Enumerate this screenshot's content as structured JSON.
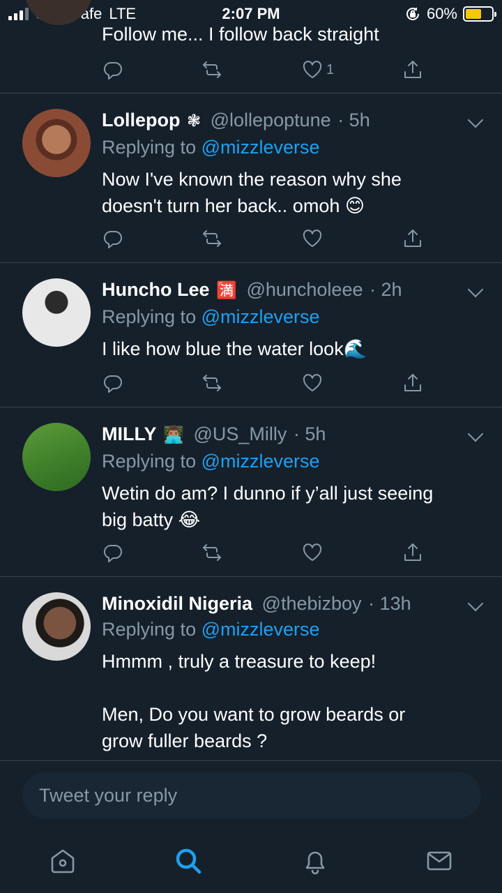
{
  "status_bar": {
    "carrier": "Stay Safe",
    "network": "LTE",
    "time": "2:07 PM",
    "battery": "60%",
    "battery_level": 0.6
  },
  "partial_tweet": {
    "text": "Follow me... I follow back straight",
    "like_count": "1"
  },
  "tweets": [
    {
      "name": "Lollepop",
      "emoji": "❃",
      "handle": "@lollepoptune",
      "time": "· 5h",
      "replying_prefix": "Replying to",
      "mention": "@mizzleverse",
      "text": "Now I've known the reason why she\ndoesn't turn her back.. omoh 😊"
    },
    {
      "name": "Huncho Lee",
      "emoji": "🈵",
      "handle": "@huncholeee",
      "time": "· 2h",
      "replying_prefix": "Replying to",
      "mention": "@mizzleverse",
      "text": "I like how blue the water look🌊"
    },
    {
      "name": "MILLY",
      "emoji": "👨🏽‍💻",
      "handle": "@US_Milly",
      "time": "· 5h",
      "replying_prefix": "Replying to",
      "mention": "@mizzleverse",
      "text": "Wetin do am? I dunno if y’all just seeing\nbig batty 😂"
    },
    {
      "name": "Minoxidil Nigeria",
      "emoji": "",
      "handle": "@thebizboy",
      "time": "· 13h",
      "replying_prefix": "Replying to",
      "mention": "@mizzleverse",
      "text": "Hmmm , truly a treasure to keep!\n\nMen, Do you want to grow beards or\ngrow fuller beards ?"
    }
  ],
  "reply_box": {
    "placeholder": "Tweet your reply"
  },
  "tab_bar": {
    "icons": [
      "home-icon",
      "search-icon",
      "notifications-icon",
      "messages-icon"
    ],
    "active": "search-icon"
  },
  "colors": {
    "background": "#15202b",
    "accent": "#1da1f2",
    "muted": "#8899a6",
    "divider": "#38444d"
  }
}
